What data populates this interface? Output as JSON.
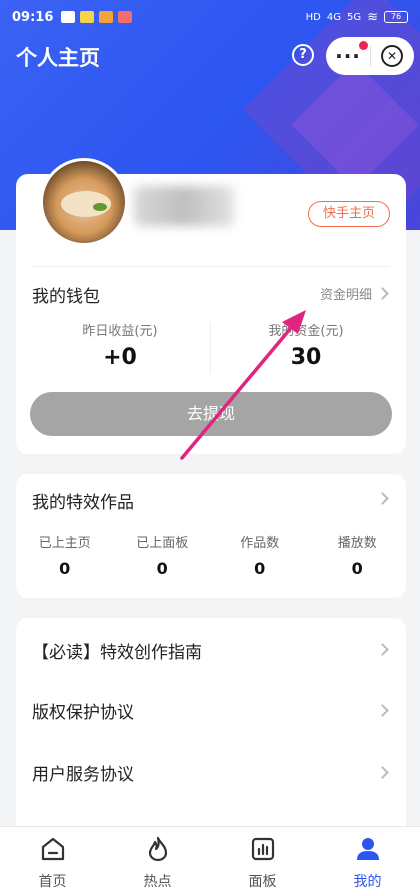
{
  "status_bar": {
    "time": "09:16",
    "network_1": "HD",
    "network_2": "4G",
    "network_3": "5G",
    "battery": "76"
  },
  "header": {
    "title": "个人主页"
  },
  "profile": {
    "kuaishou_button": "快手主页"
  },
  "wallet": {
    "title": "我的钱包",
    "detail_link": "资金明细",
    "stats": [
      {
        "label": "昨日收益(元)",
        "value": "+0"
      },
      {
        "label": "我的资金(元)",
        "value": "30"
      }
    ],
    "withdraw_button": "去提现"
  },
  "works": {
    "title": "我的特效作品",
    "items": [
      {
        "label": "已上主页",
        "value": "0"
      },
      {
        "label": "已上面板",
        "value": "0"
      },
      {
        "label": "作品数",
        "value": "0"
      },
      {
        "label": "播放数",
        "value": "0"
      }
    ]
  },
  "list": {
    "items": [
      {
        "label": "【必读】特效创作指南"
      },
      {
        "label": "版权保护协议"
      },
      {
        "label": "用户服务协议"
      }
    ]
  },
  "tabbar": {
    "items": [
      {
        "label": "首页",
        "icon": "home-icon"
      },
      {
        "label": "热点",
        "icon": "flame-icon"
      },
      {
        "label": "面板",
        "icon": "chart-icon"
      },
      {
        "label": "我的",
        "icon": "user-icon"
      }
    ]
  },
  "colors": {
    "brand_blue": "#2d55f0",
    "accent_orange": "#f26d4c",
    "annotation_arrow": "#e0257e"
  }
}
